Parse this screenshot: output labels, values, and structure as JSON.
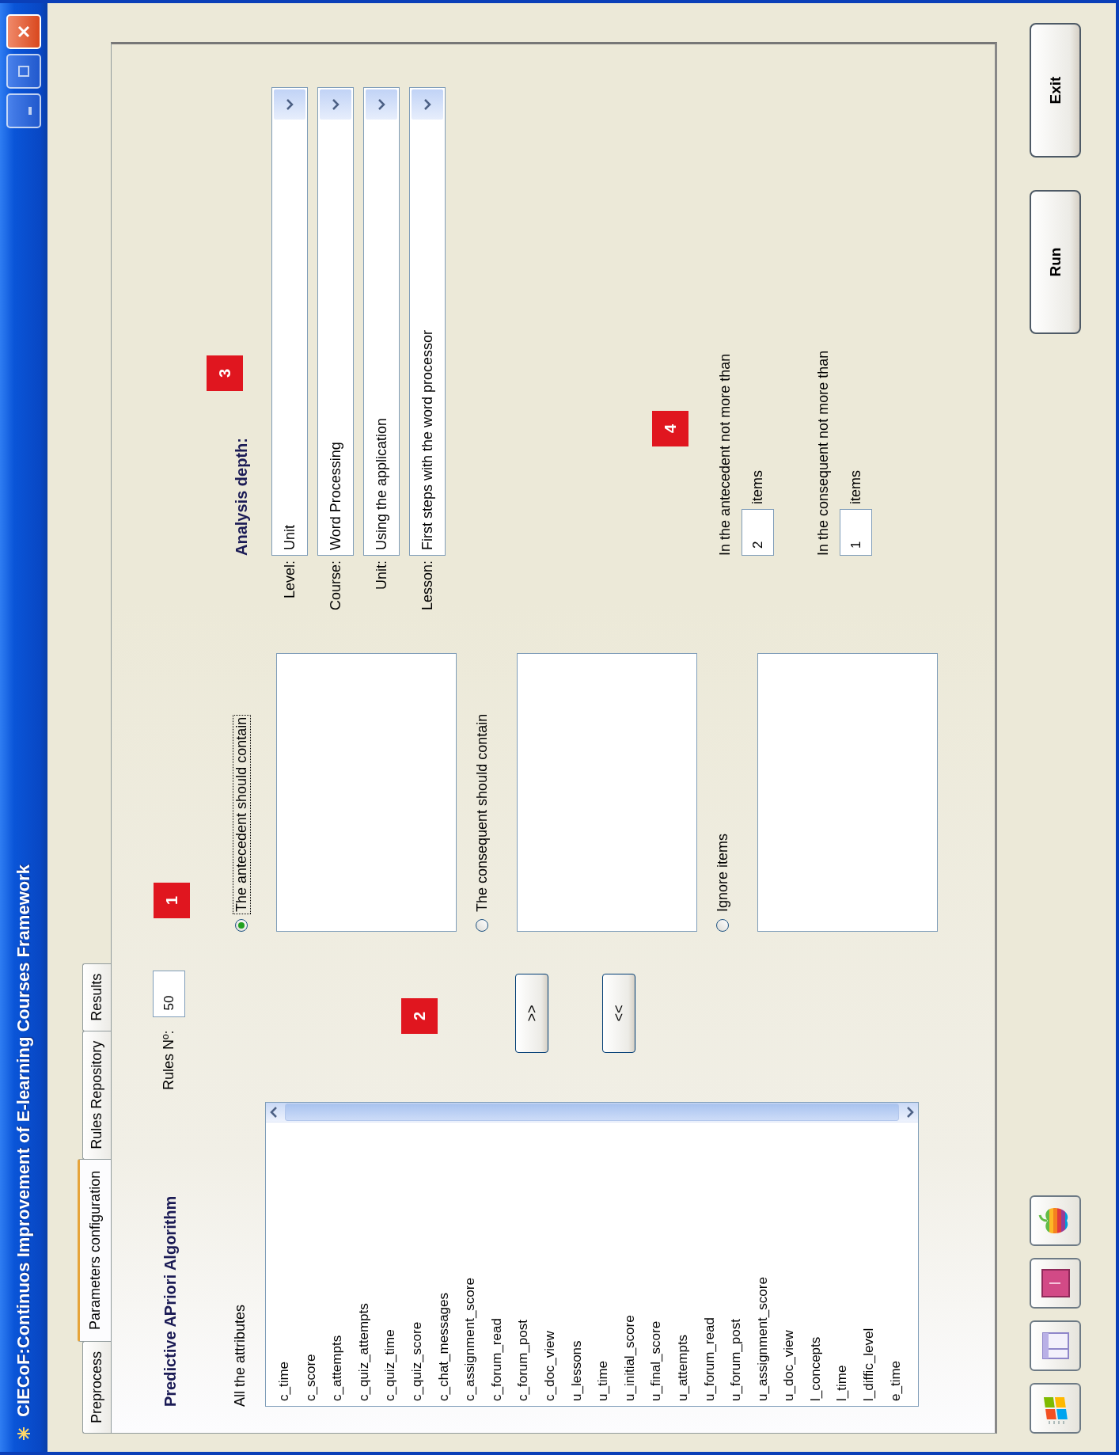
{
  "window": {
    "title": "CIECoF:Continuos Improvement of E-learning Courses Framework"
  },
  "tabs": [
    {
      "label": "Preprocess",
      "selected": false
    },
    {
      "label": "Parameters configuration",
      "selected": true
    },
    {
      "label": "Rules Repository",
      "selected": false
    },
    {
      "label": "Results",
      "selected": false
    }
  ],
  "algorithm_title": "Predictive APriori Algorithm",
  "rules_count": {
    "label": "Rules Nº:",
    "value": "50"
  },
  "attributes": {
    "label": "All the attributes",
    "items": [
      "c_time",
      "c_score",
      "c_attempts",
      "c_quiz_attempts",
      "c_quiz_time",
      "c_quiz_score",
      "c_chat_messages",
      "c_assignment_score",
      "c_forum_read",
      "c_forum_post",
      "c_doc_view",
      "u_lessons",
      "u_time",
      "u_initial_score",
      "u_final_score",
      "u_attempts",
      "u_forum_read",
      "u_forum_post",
      "u_assignment_score",
      "u_doc_view",
      "l_concepts",
      "l_time",
      "l_diffic_level",
      "e_time"
    ]
  },
  "move_buttons": [
    ">>",
    "<<"
  ],
  "item_filters": [
    {
      "label": "The antecedent should contain",
      "selected": true
    },
    {
      "label": "The consequent should contain",
      "selected": false
    },
    {
      "label": "Ignore items",
      "selected": false
    }
  ],
  "analysis_depth": {
    "title": "Analysis depth:",
    "fields": [
      {
        "label": "Level:",
        "value": "Unit"
      },
      {
        "label": "Course:",
        "value": "Word Processing"
      },
      {
        "label": "Unit:",
        "value": "Using the application"
      },
      {
        "label": "Lesson:",
        "value": "First steps with the word processor"
      }
    ]
  },
  "limits": [
    {
      "label": "In the antecedent not more than",
      "value": "2",
      "unit": "items"
    },
    {
      "label": "In the consequent not more than",
      "value": "1",
      "unit": "items"
    }
  ],
  "markers": [
    "1",
    "2",
    "3",
    "4"
  ],
  "buttons": [
    "Run",
    "Exit"
  ]
}
